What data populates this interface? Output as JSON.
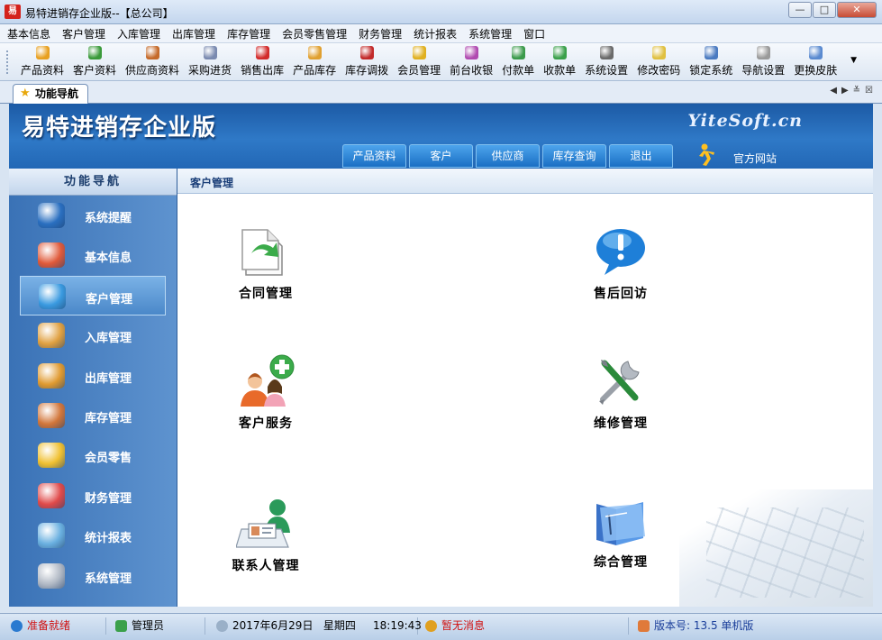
{
  "window": {
    "title": "易特进销存企业版--【总公司】",
    "app_icon": "易",
    "buttons": [
      "—",
      "□",
      "✕"
    ]
  },
  "menu": [
    "基本信息",
    "客户管理",
    "入库管理",
    "出库管理",
    "库存管理",
    "会员零售管理",
    "财务管理",
    "统计报表",
    "系统管理",
    "窗口"
  ],
  "toolbar": [
    {
      "label": "产品资料",
      "icon": "product-icon",
      "color": "#e8a020"
    },
    {
      "label": "客户资料",
      "icon": "customer-icon",
      "color": "#3a9a3a"
    },
    {
      "label": "供应商资料",
      "icon": "supplier-icon",
      "color": "#c56a2a"
    },
    {
      "label": "采购进货",
      "icon": "purchase-icon",
      "color": "#7a8ab0"
    },
    {
      "label": "销售出库",
      "icon": "sales-icon",
      "color": "#d22a2a"
    },
    {
      "label": "产品库存",
      "icon": "inventory-icon",
      "color": "#e0a030"
    },
    {
      "label": "库存调拨",
      "icon": "transfer-icon",
      "color": "#c22a2a"
    },
    {
      "label": "会员管理",
      "icon": "member-icon",
      "color": "#e0b020"
    },
    {
      "label": "前台收银",
      "icon": "cashier-icon",
      "color": "#b04ab0"
    },
    {
      "label": "付款单",
      "icon": "payment-icon",
      "color": "#3a9a4a"
    },
    {
      "label": "收款单",
      "icon": "receipt-icon",
      "color": "#3aa04a"
    },
    {
      "label": "系统设置",
      "icon": "settings-icon",
      "color": "#6a6a6a"
    },
    {
      "label": "修改密码",
      "icon": "key-icon",
      "color": "#e0c040"
    },
    {
      "label": "锁定系统",
      "icon": "lock-icon",
      "color": "#4a7ac0"
    },
    {
      "label": "导航设置",
      "icon": "nav-settings-icon",
      "color": "#9a9a9a"
    },
    {
      "label": "更换皮肤",
      "icon": "skin-icon",
      "color": "#5a8ad0"
    }
  ],
  "tab": {
    "label": "功能导航"
  },
  "banner": {
    "title": "易特进销存企业版",
    "brand": "YiteSoft.cn",
    "nav": [
      "产品资料",
      "客户",
      "供应商",
      "库存查询",
      "退出"
    ],
    "official_site": "官方网站"
  },
  "sidebar": {
    "heading": "功能导航",
    "items": [
      {
        "label": "系统提醒",
        "icon": "info-icon",
        "color": "#2a6fc0"
      },
      {
        "label": "基本信息",
        "icon": "cubes-icon",
        "color": "#e05a3a"
      },
      {
        "label": "客户管理",
        "icon": "users-icon",
        "color": "#3a9ae0",
        "active": true
      },
      {
        "label": "入库管理",
        "icon": "box-in-icon",
        "color": "#e0a040"
      },
      {
        "label": "出库管理",
        "icon": "box-out-icon",
        "color": "#e09a30"
      },
      {
        "label": "库存管理",
        "icon": "warehouse-icon",
        "color": "#d2763a"
      },
      {
        "label": "会员零售",
        "icon": "member-retail-icon",
        "color": "#f0c030"
      },
      {
        "label": "财务管理",
        "icon": "finance-icon",
        "color": "#e04a4a"
      },
      {
        "label": "统计报表",
        "icon": "report-icon",
        "color": "#6ab0e0"
      },
      {
        "label": "系统管理",
        "icon": "gears-icon",
        "color": "#b0b8c4"
      }
    ]
  },
  "main": {
    "header": "客户管理",
    "functions": [
      {
        "label": "合同管理",
        "icon": "contract-icon"
      },
      {
        "label": "售后回访",
        "icon": "speech-bubble-icon"
      },
      {
        "label": "客户服务",
        "icon": "add-customer-icon"
      },
      {
        "label": "维修管理",
        "icon": "tools-icon"
      },
      {
        "label": "联系人管理",
        "icon": "contact-card-icon"
      },
      {
        "label": "综合管理",
        "icon": "folder-icon"
      }
    ]
  },
  "status": {
    "ready": "准备就绪",
    "user": "管理员",
    "date": "2017年6月29日",
    "weekday": "星期四",
    "time": "18:19:43",
    "messages": "暂无消息",
    "version": "版本号: 13.5 单机版"
  }
}
